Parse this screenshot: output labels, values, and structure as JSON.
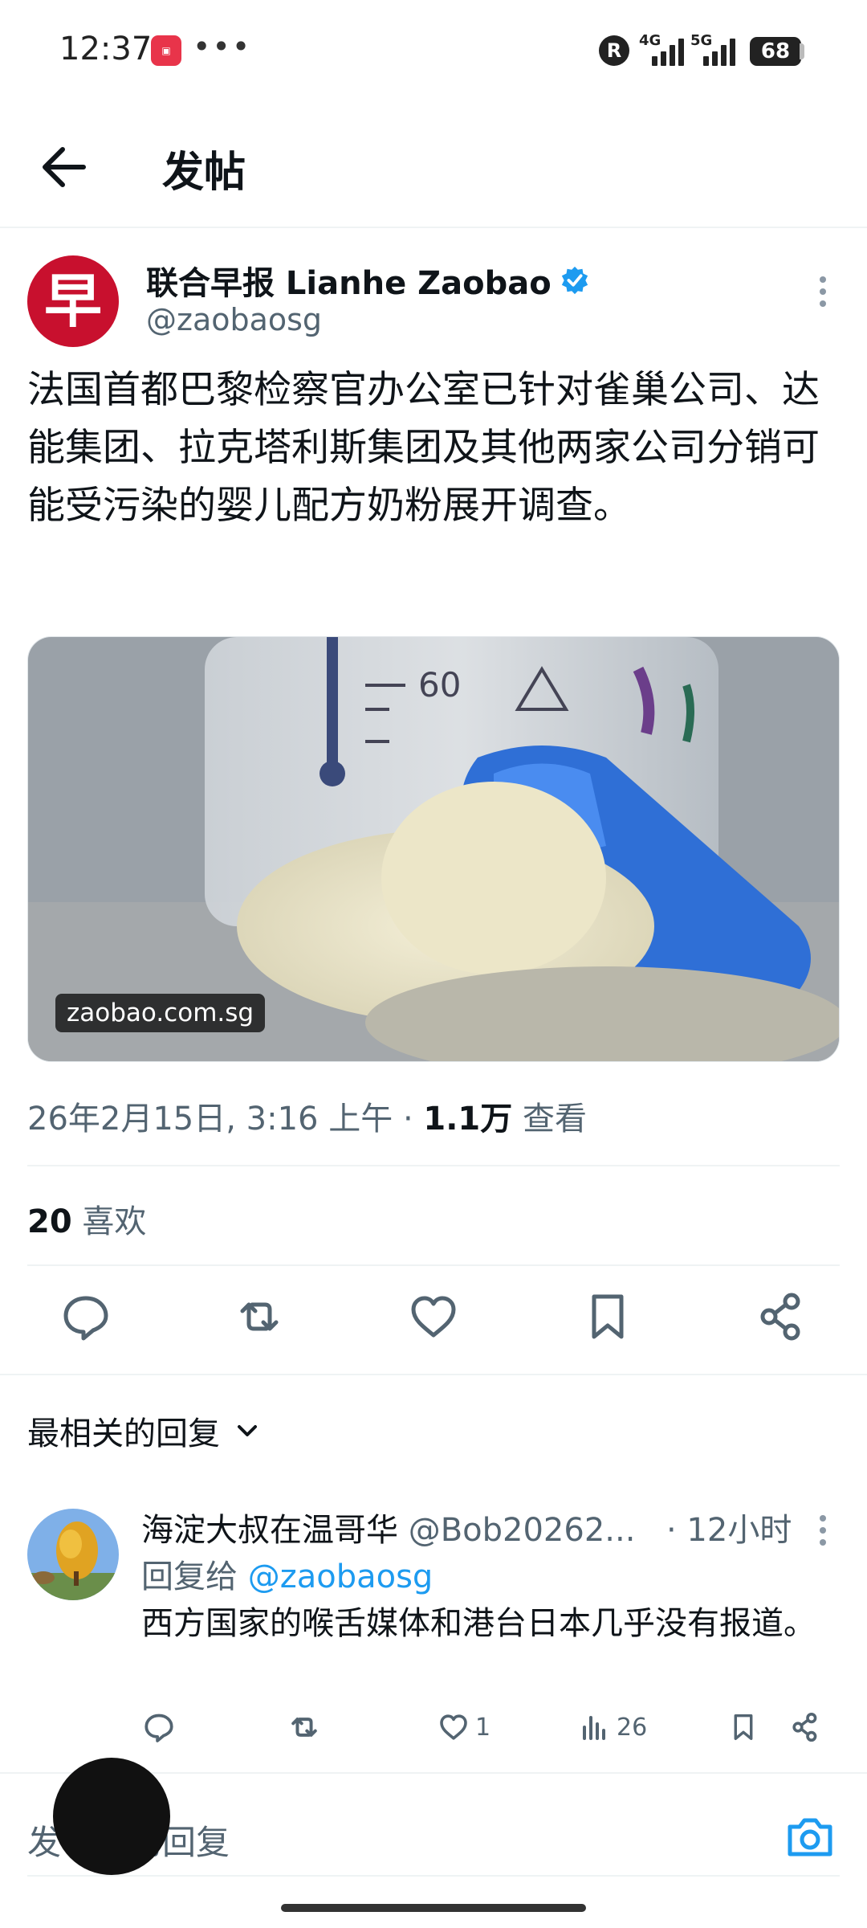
{
  "status_bar": {
    "time": "12:37",
    "app_badge_icon": "xiaohongshu-app-icon",
    "overflow": "•••",
    "r_badge": "R",
    "net1": "4G",
    "net2": "5G",
    "battery": "68"
  },
  "header": {
    "title": "发帖"
  },
  "post": {
    "avatar_glyph": "早",
    "author_name": "联合早报 Lianhe Zaobao",
    "handle": "@zaobaosg",
    "text": "法国首都巴黎检察官办公室已针对雀巢公司、达能集团、拉克塔利斯集团及其他两家公司分销可能受污染的婴儿配方奶粉展开调查。",
    "media": {
      "source_label": "zaobao.com.sg",
      "measure_mark": "60"
    },
    "date": "26年2月15日, 3:16 上午",
    "dot": "·",
    "views_count": "1.1万",
    "views_label": "查看",
    "likes_count": "20",
    "likes_label": "喜欢"
  },
  "replies_sort": {
    "label": "最相关的回复"
  },
  "reply": {
    "name": "海淀大叔在温哥华",
    "handle": "@Bob20262...",
    "time": "· 12小时",
    "reply_to_prefix": "回复给",
    "reply_to_handle": "@zaobaosg",
    "text": "西方国家的喉舌媒体和港台日本几乎没有报道。",
    "likes": "1",
    "views": "26"
  },
  "composer": {
    "placeholder": "发布你的回复"
  },
  "colors": {
    "accent": "#1d9bf0",
    "zaobao_red": "#c8102e",
    "text_primary": "#0f1419",
    "text_secondary": "#536471"
  }
}
